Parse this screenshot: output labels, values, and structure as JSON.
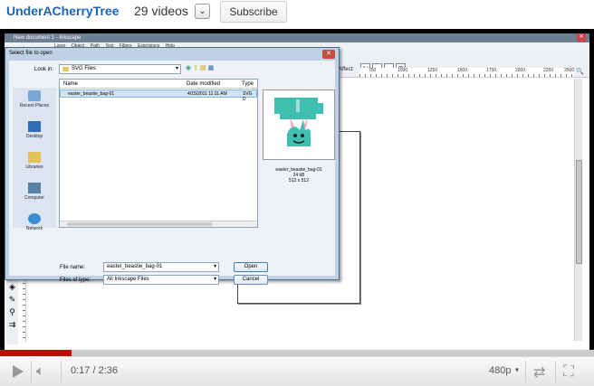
{
  "header": {
    "channel": "UnderACherryTree",
    "videos": "29 videos",
    "dropdown_icon": "chevron-down-icon",
    "subscribe": "Subscribe"
  },
  "inkscape": {
    "window_title": "New document 1 - Inkscape",
    "menu": [
      "Layer",
      "Object",
      "Path",
      "Text",
      "Filters",
      "Extensions",
      "Help"
    ],
    "affect_label": "Affect:",
    "ruler_labels": [
      "750",
      "1000",
      "1250",
      "1500",
      "1750",
      "2000",
      "2250",
      "2500"
    ]
  },
  "dialog": {
    "title": "Select file to open",
    "look_in_label": "Look in:",
    "look_in_value": "SVG Files",
    "places": [
      "Recent Places",
      "Desktop",
      "Libraries",
      "Computer",
      "Network"
    ],
    "columns": [
      "Name",
      "Date modified",
      "Type"
    ],
    "files": [
      {
        "name": "easter_beastie_bag-01",
        "date": "4/15/2011 11:11 AM",
        "type": "SVG D"
      }
    ],
    "preview_caption_name": "easter_beastie_bag-01",
    "preview_caption_size": "24 kB",
    "preview_caption_dims": "512 x 512",
    "file_name_label": "File name:",
    "file_name_value": "easter_beastie_bag-01",
    "files_of_type_label": "Files of type:",
    "files_of_type_value": "All Inkscape Files",
    "open_button": "Open",
    "cancel_button": "Cancel"
  },
  "player": {
    "progress": 0.12,
    "time": "0:17 / 2:36",
    "quality": "480p",
    "colors": {
      "played": "#cc0000",
      "channel": "#1c62b9"
    }
  }
}
